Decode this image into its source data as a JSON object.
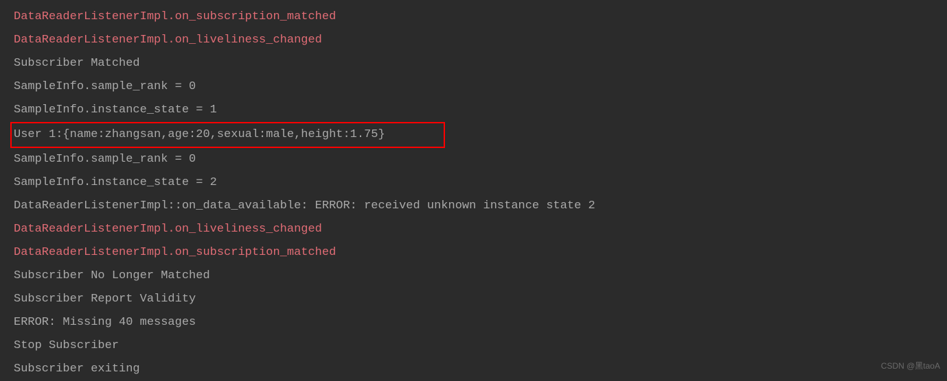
{
  "lines": [
    {
      "text": "DataReaderListenerImpl.on_subscription_matched",
      "highlight": true,
      "boxed": false
    },
    {
      "text": "DataReaderListenerImpl.on_liveliness_changed",
      "highlight": true,
      "boxed": false
    },
    {
      "text": "Subscriber Matched",
      "highlight": false,
      "boxed": false
    },
    {
      "text": "SampleInfo.sample_rank = 0",
      "highlight": false,
      "boxed": false
    },
    {
      "text": "SampleInfo.instance_state = 1",
      "highlight": false,
      "boxed": false
    },
    {
      "text": "User 1:{name:zhangsan,age:20,sexual:male,height:1.75}",
      "highlight": false,
      "boxed": true
    },
    {
      "text": "SampleInfo.sample_rank = 0",
      "highlight": false,
      "boxed": false
    },
    {
      "text": "SampleInfo.instance_state = 2",
      "highlight": false,
      "boxed": false
    },
    {
      "text": "DataReaderListenerImpl::on_data_available: ERROR: received unknown instance state 2",
      "highlight": false,
      "boxed": false
    },
    {
      "text": "DataReaderListenerImpl.on_liveliness_changed",
      "highlight": true,
      "boxed": false
    },
    {
      "text": "DataReaderListenerImpl.on_subscription_matched",
      "highlight": true,
      "boxed": false
    },
    {
      "text": "Subscriber No Longer Matched",
      "highlight": false,
      "boxed": false
    },
    {
      "text": "Subscriber Report Validity",
      "highlight": false,
      "boxed": false
    },
    {
      "text": "ERROR: Missing 40 messages",
      "highlight": false,
      "boxed": false
    },
    {
      "text": "Stop Subscriber",
      "highlight": false,
      "boxed": false
    },
    {
      "text": "Subscriber exiting",
      "highlight": false,
      "boxed": false
    }
  ],
  "watermark": "CSDN @黑taoA"
}
